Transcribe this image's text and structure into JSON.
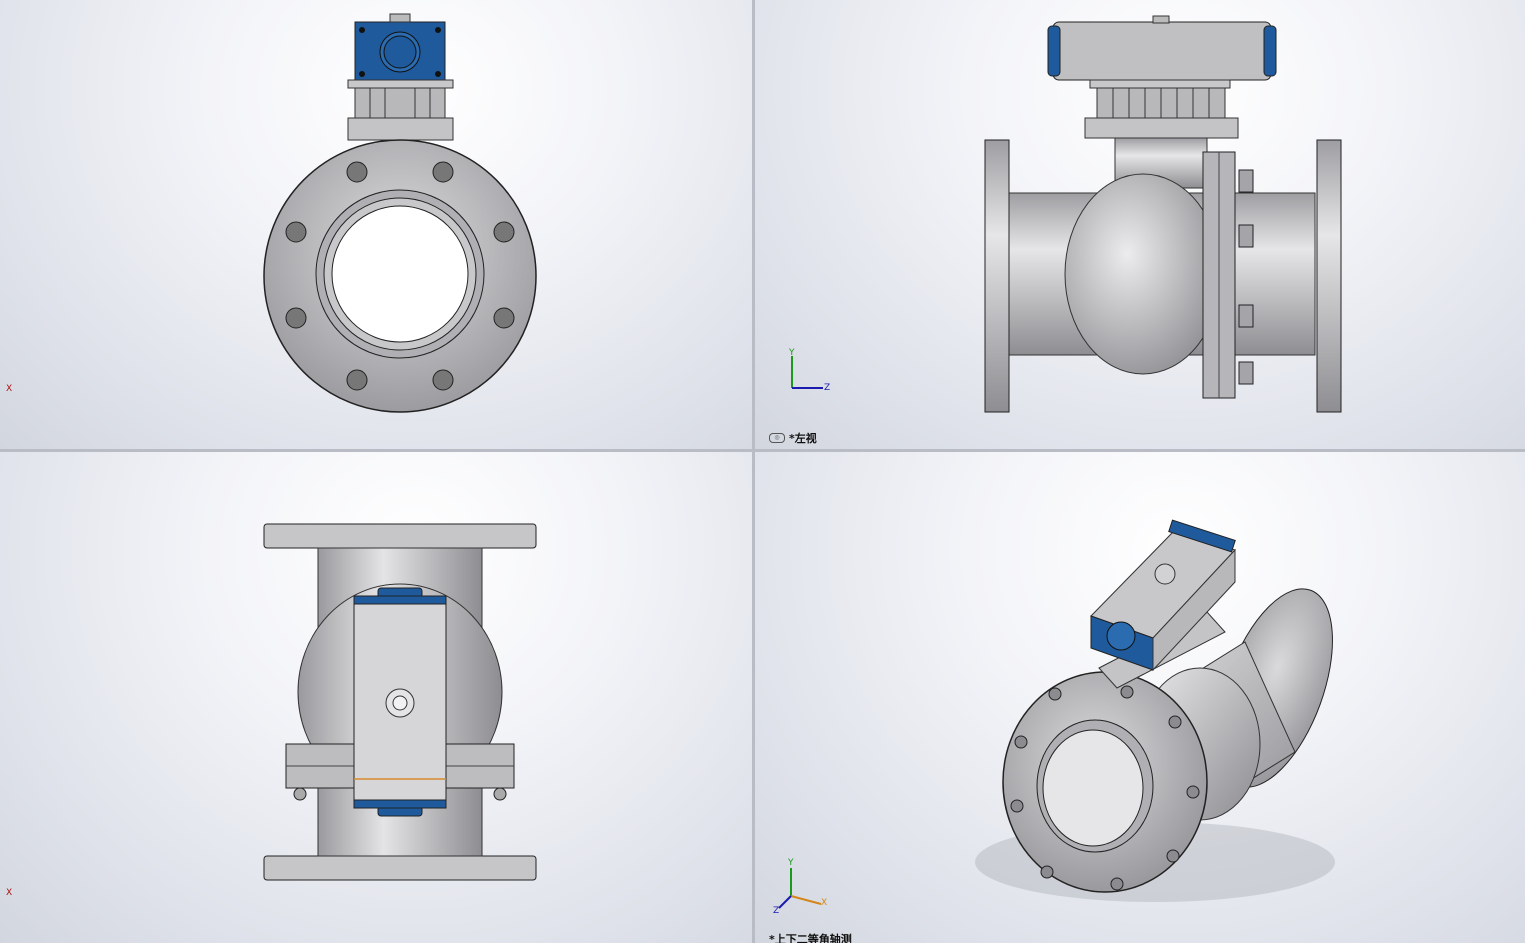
{
  "viewports": {
    "top_left": {
      "label": ""
    },
    "top_right": {
      "label": "*左视"
    },
    "bottom_left": {
      "label": ""
    },
    "bottom_right": {
      "label": "*上下二等角轴测"
    }
  },
  "triad": {
    "x": "X",
    "y": "Y",
    "z": "Z"
  },
  "colors": {
    "steel": "#c4c4c6",
    "steel_dark": "#8a8a8e",
    "actuator_blue": "#1f5a9c",
    "outline": "#2a2a2a"
  }
}
